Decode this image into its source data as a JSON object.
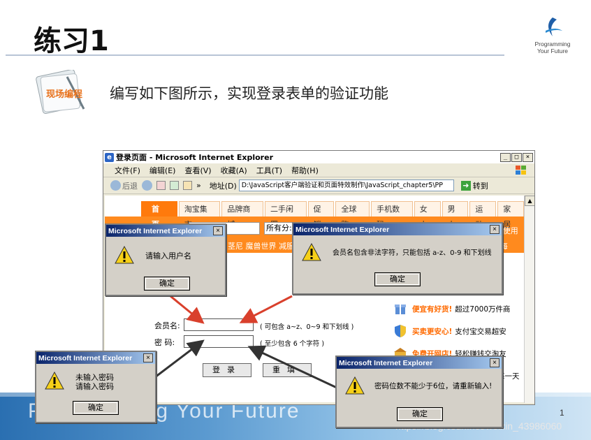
{
  "slide": {
    "title": "练习1",
    "logo_line1": "Programming",
    "logo_line2": "Your Future",
    "badge_label": "现场编程",
    "instruction": "编写如下图所示，实现登录表单的验证功能",
    "bottom_motto": "Programming Your Future",
    "page_number": "1",
    "watermark": "https://blog.csdn.net/weixin_43986060"
  },
  "browser": {
    "window_title": "登录页面 - Microsoft Internet Explorer",
    "menu": [
      "文件(F)",
      "编辑(E)",
      "查看(V)",
      "收藏(A)",
      "工具(T)",
      "帮助(H)"
    ],
    "back_label": "后退",
    "more_label": "»",
    "address_label": "地址(D)",
    "address_value": "D:\\JavaScript客户端验证和页面特效制作\\JavaScript_chapter5\\PP",
    "go_label": "转到",
    "tabs": [
      "首页",
      "淘宝集市",
      "品牌商城",
      "二手闲置",
      "促销",
      "全球购",
      "手机数码",
      "女人",
      "男人",
      "运动",
      "家居"
    ],
    "all_categories": "所有分:",
    "promo_text": "茎尼  魔兽世界  减服",
    "orange_right": "[ 使用",
    "orange_right2": "每",
    "form": {
      "username_label": "会员名:",
      "username_hint": "( 可包含  a~z、0~9 和下划线 )",
      "password_label": "密    码:",
      "password_hint": "( 至少包含  6  个字符 )",
      "submit_label": "登录",
      "reset_label": "重填"
    },
    "side_items": [
      {
        "bold": "便宜有好货!",
        "text": "超过7000万件商"
      },
      {
        "bold": "买卖更安心!",
        "text": "支付宝交易超安"
      },
      {
        "bold": "免费开网店!",
        "text": "轻松赚钱交淘友"
      }
    ],
    "side_tail": "每一天"
  },
  "dialogs": {
    "title": "Microsoft Internet Explorer",
    "ok_label": "确定",
    "close_label": "×",
    "username_empty": "请输入用户名",
    "username_invalid": "会员名包含非法字符，只能包括 a-z、0-9 和下划线",
    "password_empty_line1": "未输入密码",
    "password_empty_line2": "请输入密码",
    "password_short": "密码位数不能少于6位，请重新输入!"
  }
}
